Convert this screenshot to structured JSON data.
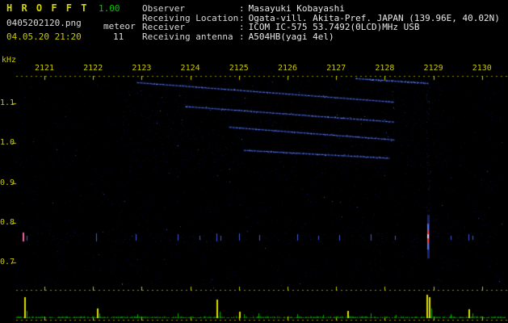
{
  "app": {
    "title": "H R O F F T",
    "version": "1.00",
    "filename": "0405202120.png",
    "mode": "meteor",
    "datetime": "04.05.20 21:20",
    "count": "11"
  },
  "info": {
    "separator": ":",
    "rows": [
      {
        "label": "Observer",
        "value": "Masayuki Kobayashi"
      },
      {
        "label": "Receiving Location",
        "value": "Ogata-vill. Akita-Pref. JAPAN (139.96E, 40.02N)"
      },
      {
        "label": "Receiver",
        "value": "ICOM IC-575 53.7492(0LCD)MHz USB"
      },
      {
        "label": "Receiving antenna",
        "value": "A504HB(yagi 4el)"
      }
    ]
  },
  "chart_data": {
    "type": "heatmap",
    "x_axis": {
      "ticks": [
        2121,
        2122,
        2123,
        2124,
        2125,
        2126,
        2127,
        2128,
        2129,
        2130
      ],
      "range": [
        2120.4,
        2130.5
      ]
    },
    "y_axis": {
      "unit": "kHz",
      "ticks": [
        1.1,
        1.0,
        0.9,
        0.8,
        0.7
      ],
      "range": [
        0.63,
        1.17
      ]
    },
    "traces": [
      {
        "t1": 2122.9,
        "f1": 1.152,
        "t2": 2128.2,
        "f2": 1.103
      },
      {
        "t1": 2123.9,
        "f1": 1.092,
        "t2": 2128.2,
        "f2": 1.053
      },
      {
        "t1": 2124.8,
        "f1": 1.04,
        "t2": 2128.2,
        "f2": 1.008
      },
      {
        "t1": 2125.1,
        "f1": 0.982,
        "t2": 2128.1,
        "f2": 0.962
      },
      {
        "t1": 2127.4,
        "f1": 1.162,
        "t2": 2128.9,
        "f2": 1.15
      }
    ],
    "echoes": [
      {
        "t": 2120.55,
        "f": 0.764,
        "len": 0.022,
        "color": "pink"
      },
      {
        "t": 2120.63,
        "f": 0.762,
        "len": 0.012,
        "color": "blue"
      },
      {
        "t": 2122.07,
        "f": 0.764,
        "len": 0.02,
        "color": "blue"
      },
      {
        "t": 2122.88,
        "f": 0.763,
        "len": 0.016,
        "color": "blue"
      },
      {
        "t": 2123.74,
        "f": 0.764,
        "len": 0.016,
        "color": "blue"
      },
      {
        "t": 2124.19,
        "f": 0.762,
        "len": 0.01,
        "color": "blue"
      },
      {
        "t": 2124.54,
        "f": 0.764,
        "len": 0.02,
        "color": "blue"
      },
      {
        "t": 2124.62,
        "f": 0.762,
        "len": 0.012,
        "color": "blue"
      },
      {
        "t": 2125.0,
        "f": 0.764,
        "len": 0.018,
        "color": "blue"
      },
      {
        "t": 2125.42,
        "f": 0.763,
        "len": 0.014,
        "color": "blue"
      },
      {
        "t": 2126.2,
        "f": 0.764,
        "len": 0.016,
        "color": "blue"
      },
      {
        "t": 2126.63,
        "f": 0.762,
        "len": 0.01,
        "color": "blue"
      },
      {
        "t": 2127.06,
        "f": 0.763,
        "len": 0.014,
        "color": "blue"
      },
      {
        "t": 2127.71,
        "f": 0.764,
        "len": 0.016,
        "color": "blue"
      },
      {
        "t": 2128.21,
        "f": 0.762,
        "len": 0.01,
        "color": "blue"
      },
      {
        "t": 2128.89,
        "f": 0.765,
        "len": 0.06,
        "color": "strong"
      },
      {
        "t": 2129.36,
        "f": 0.762,
        "len": 0.01,
        "color": "blue"
      },
      {
        "t": 2129.72,
        "f": 0.763,
        "len": 0.016,
        "color": "blue"
      },
      {
        "t": 2129.8,
        "f": 0.762,
        "len": 0.01,
        "color": "blue"
      }
    ],
    "level_bars": [
      {
        "t": 2120.58,
        "level": 0.85,
        "color": "yellow"
      },
      {
        "t": 2120.64,
        "level": 0.3,
        "color": "green"
      },
      {
        "t": 2122.08,
        "level": 0.4,
        "color": "yellow"
      },
      {
        "t": 2122.13,
        "level": 0.2,
        "color": "green"
      },
      {
        "t": 2122.91,
        "level": 0.18,
        "color": "green"
      },
      {
        "t": 2123.74,
        "level": 0.2,
        "color": "green"
      },
      {
        "t": 2124.54,
        "level": 0.78,
        "color": "yellow"
      },
      {
        "t": 2124.6,
        "level": 0.25,
        "color": "green"
      },
      {
        "t": 2125.0,
        "level": 0.28,
        "color": "yellow"
      },
      {
        "t": 2125.1,
        "level": 0.15,
        "color": "green"
      },
      {
        "t": 2125.4,
        "level": 0.2,
        "color": "green"
      },
      {
        "t": 2126.2,
        "level": 0.18,
        "color": "green"
      },
      {
        "t": 2126.73,
        "level": 0.12,
        "color": "green"
      },
      {
        "t": 2127.23,
        "level": 0.3,
        "color": "yellow"
      },
      {
        "t": 2127.71,
        "level": 0.2,
        "color": "green"
      },
      {
        "t": 2128.22,
        "level": 0.12,
        "color": "green"
      },
      {
        "t": 2128.86,
        "level": 0.95,
        "color": "yellow"
      },
      {
        "t": 2128.91,
        "level": 0.88,
        "color": "yellow"
      },
      {
        "t": 2128.96,
        "level": 0.4,
        "color": "green"
      },
      {
        "t": 2129.36,
        "level": 0.15,
        "color": "green"
      },
      {
        "t": 2129.72,
        "level": 0.35,
        "color": "yellow"
      },
      {
        "t": 2129.8,
        "level": 0.2,
        "color": "green"
      }
    ],
    "colors": {
      "axis": "#c8c800",
      "trace": "#5f87ff",
      "echo": "#4b64f0",
      "strong_echo_core": "#ff4646",
      "level_yellow": "#dede00",
      "level_green": "#00a800"
    }
  }
}
